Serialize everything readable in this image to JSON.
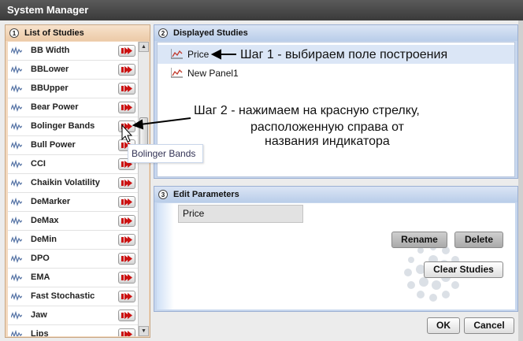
{
  "window": {
    "title": "System Manager"
  },
  "left_panel": {
    "number": "1",
    "title": "List of Studies",
    "items": [
      "BB Width",
      "BBLower",
      "BBUpper",
      "Bear Power",
      "Bolinger Bands",
      "Bull Power",
      "CCI",
      "Chaikin Volatility",
      "DeMarker",
      "DeMax",
      "DeMin",
      "DPO",
      "EMA",
      "Fast Stochastic",
      "Jaw",
      "Lips"
    ],
    "tooltip": "Bolinger Bands"
  },
  "displayed_panel": {
    "number": "2",
    "title": "Displayed Studies",
    "items": [
      {
        "label": "Price",
        "selected": true
      },
      {
        "label": "New Panel1",
        "selected": false
      }
    ]
  },
  "params_panel": {
    "number": "3",
    "title": "Edit Parameters",
    "field_value": "Price",
    "rename_label": "Rename",
    "delete_label": "Delete",
    "clear_label": "Clear Studies"
  },
  "footer": {
    "ok_label": "OK",
    "cancel_label": "Cancel"
  },
  "annotations": {
    "step1": "Шаг 1 - выбираем поле построения",
    "step2_line1": "Шаг 2 - нажимаем на красную стрелку,",
    "step2_line2": "расположенную справа от",
    "step2_line3": "названия индикатора"
  },
  "colors": {
    "add_arrow": "#cc1111",
    "selected_row": "#dbe6f6",
    "left_bg": "#f3d8bd",
    "right_bg": "#c7d7ee"
  }
}
